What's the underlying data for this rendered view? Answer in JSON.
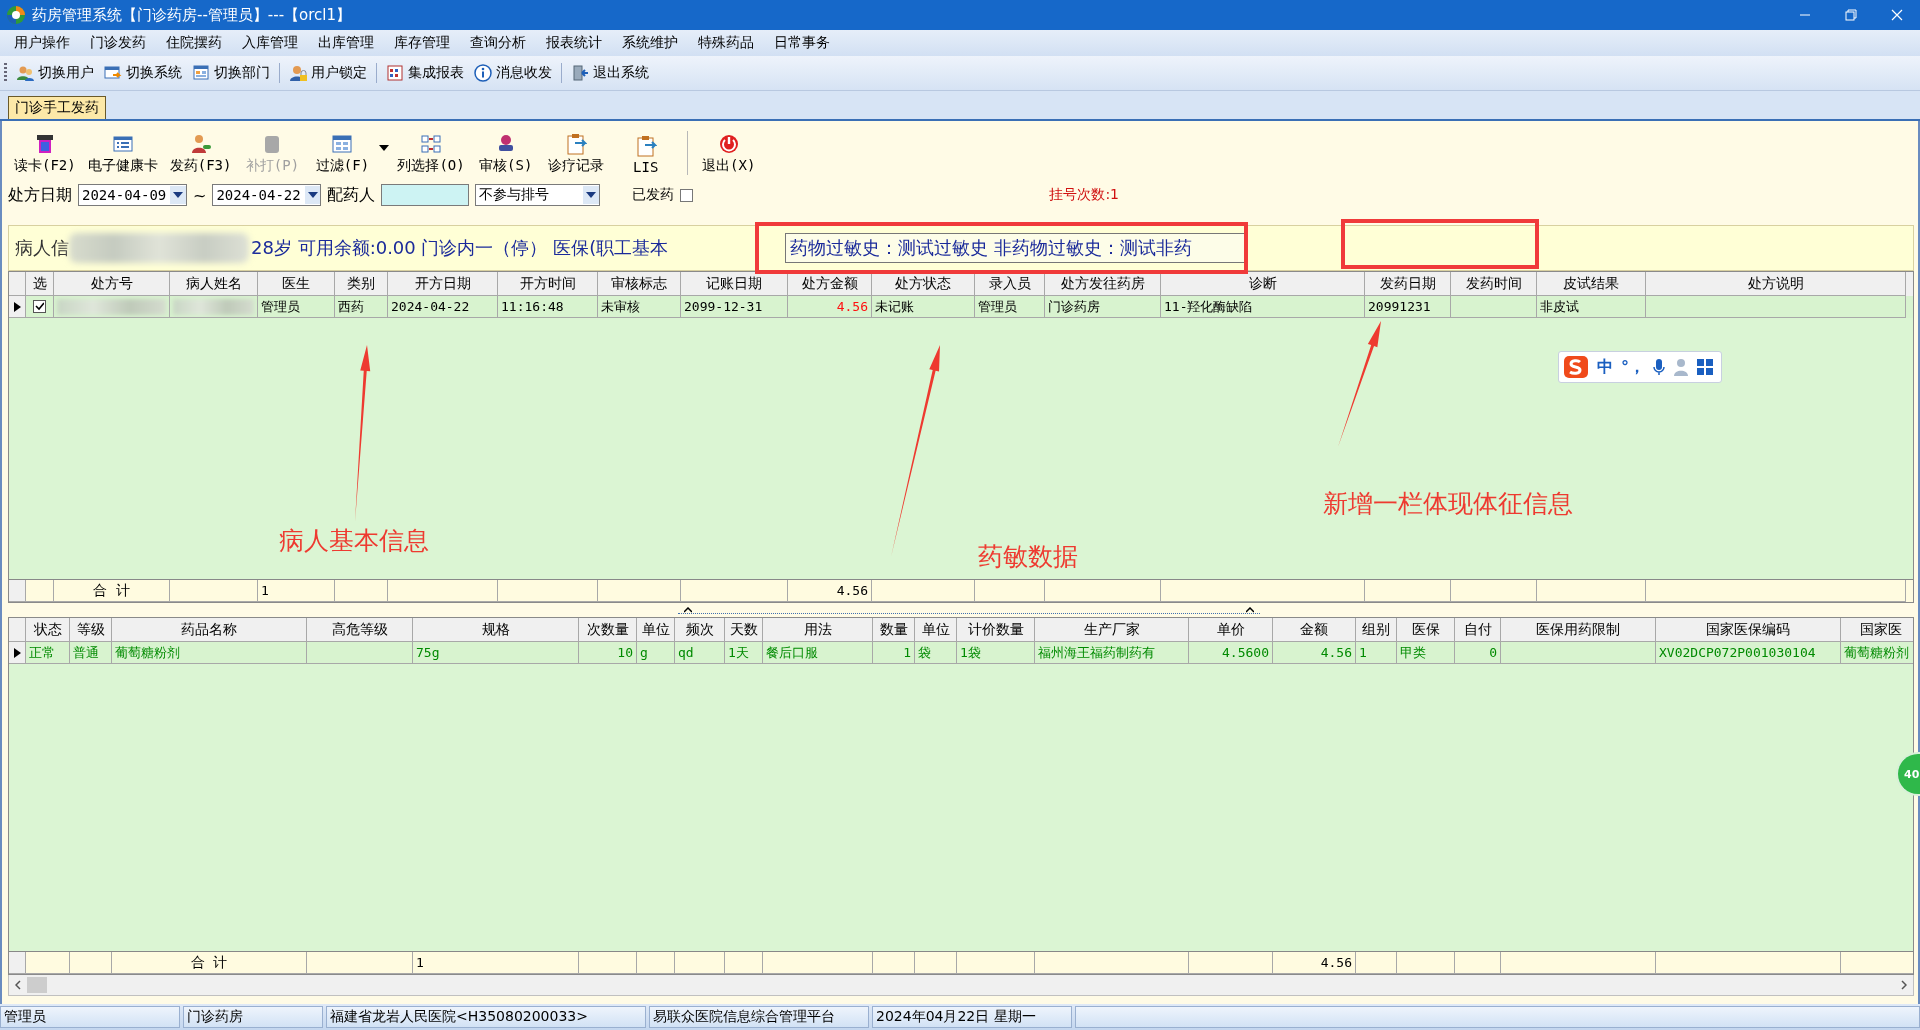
{
  "window": {
    "title": "药房管理系统【门诊药房--管理员】---【orcl1】"
  },
  "menu": [
    "用户操作",
    "门诊发药",
    "住院摆药",
    "入库管理",
    "出库管理",
    "库存管理",
    "查询分析",
    "报表统计",
    "系统维护",
    "特殊药品",
    "日常事务"
  ],
  "toolbar": {
    "groups": [
      [
        "切换用户",
        "切换系统",
        "切换部门"
      ],
      [
        "用户锁定"
      ],
      [
        "集成报表",
        "消息收发"
      ],
      [
        "退出系统"
      ]
    ]
  },
  "tabs": [
    {
      "label": "门诊手工发药",
      "selected": true
    }
  ],
  "actions": [
    [
      {
        "label": "读卡(F2)",
        "disabled": false
      },
      {
        "label": "电子健康卡",
        "disabled": false
      },
      {
        "label": "发药(F3)",
        "disabled": false
      },
      {
        "label": "补打(P)",
        "disabled": true
      },
      {
        "label": "过滤(F)",
        "disabled": false
      },
      {
        "label": "列选择(O)",
        "disabled": false
      },
      {
        "label": "审核(S)",
        "disabled": false
      },
      {
        "label": "诊疗记录",
        "disabled": false
      },
      {
        "label": "LIS",
        "disabled": false
      }
    ],
    [
      {
        "label": "退出(X)",
        "disabled": false
      }
    ]
  ],
  "filter": {
    "date_label": "处方日期",
    "date_from": "2024-04-09",
    "range_sep": "~",
    "date_to": "2024-04-22",
    "dispenser_label": "配药人",
    "queue_option": "不参与排号",
    "dispensed_label": "已发药",
    "dispensed_checked": false,
    "visit_count": "挂号次数:1"
  },
  "patient_info": {
    "label": "病人信",
    "summary": "28岁  可用余额:0.00 门诊内一（停）  医保(职工基本",
    "allergy": "药物过敏史：测试过敏史 非药物过敏史：测试非药"
  },
  "upper_grid": {
    "columns": [
      "选",
      "处方号",
      "病人姓名",
      "医生",
      "类别",
      "开方日期",
      "开方时间",
      "审核标志",
      "记账日期",
      "处方金额",
      "处方状态",
      "录入员",
      "处方发往药房",
      "诊断",
      "发药日期",
      "发药时间",
      "皮试结果",
      "处方说明"
    ],
    "rows": [
      {
        "current": true,
        "checked": true,
        "cells": [
          {
            "kind": "check"
          },
          {
            "kind": "blurred"
          },
          {
            "kind": "blurred"
          },
          "管理员",
          "西药",
          "2024-04-22",
          "11:16:48",
          "未审核",
          "2099-12-31",
          {
            "kind": "amount",
            "text": "4.56"
          },
          "未记账",
          "管理员",
          "门诊药房",
          "11-羟化酶缺陷",
          "20991231",
          {
            "kind": "blank"
          },
          "非皮试",
          {
            "kind": "blank"
          }
        ]
      }
    ],
    "totals": {
      "label": "合  计",
      "count": "1",
      "amount": "4.56"
    }
  },
  "lower_grid": {
    "columns": [
      "状态",
      "等级",
      "药品名称",
      "高危等级",
      "规格",
      "次数量",
      "单位",
      "频次",
      "天数",
      "用法",
      "数量",
      "单位",
      "计价数量",
      "生产厂家",
      "单价",
      "金额",
      "组别",
      "医保",
      "自付",
      "医保用药限制",
      "国家医保编码",
      "国家医"
    ],
    "rows": [
      {
        "current": true,
        "cells": [
          "正常",
          "普通",
          "葡萄糖粉剂",
          {
            "kind": "blank"
          },
          "75g",
          "10",
          "g",
          "qd",
          "1天",
          "餐后口服",
          "1",
          "袋",
          "1袋",
          "福州海王福药制药有",
          "4.5600",
          "4.56",
          "1",
          "甲类",
          "0",
          {
            "kind": "blank"
          },
          "XV02DCP072P001030104",
          "葡萄糖粉剂"
        ]
      }
    ],
    "totals": {
      "label": "合  计",
      "count": "1",
      "amount": "4.56"
    }
  },
  "status_bar": [
    "管理员",
    "门诊药房",
    "福建省龙岩人民医院<H35080200033>",
    "易联众医院信息综合管理平台",
    "2024年04月22日 星期一"
  ],
  "ime_toolbar": {
    "mode": "中",
    "punctuation": "°，"
  },
  "floating_badge": "40",
  "annotation_labels": [
    "病人基本信息",
    "药敏数据",
    "新增一栏体现体征信息"
  ]
}
